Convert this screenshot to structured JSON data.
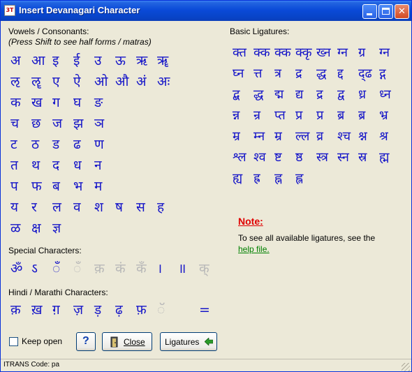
{
  "window": {
    "title": "Insert Devanagari Character",
    "app_icon_text": "3T",
    "controls": {
      "minimize_icon": "minimize-icon",
      "maximize_icon": "maximize-icon",
      "close_glyph": "✕"
    }
  },
  "sections": {
    "vowels_title": "Vowels / Consonants:",
    "vowels_hint": "(Press Shift to see half forms / matras)",
    "special_title": "Special Characters:",
    "hindi_title": "Hindi / Marathi Characters:",
    "ligatures_title": "Basic Ligatures:"
  },
  "vowels_rows": [
    [
      "अ",
      "आ",
      "इ",
      "ई",
      "उ",
      "ऊ",
      "ऋ",
      "ॠ"
    ],
    [
      "ऌ",
      "ॡ",
      "ए",
      "ऐ",
      "ओ",
      "औ",
      "अं",
      "अः"
    ],
    [
      "क",
      "ख",
      "ग",
      "घ",
      "ङ"
    ],
    [
      "च",
      "छ",
      "ज",
      "झ",
      "ञ"
    ],
    [
      "ट",
      "ठ",
      "ड",
      "ढ",
      "ण"
    ],
    [
      "त",
      "थ",
      "द",
      "ध",
      "न"
    ],
    [
      "प",
      "फ",
      "ब",
      "भ",
      "म"
    ],
    [
      "य",
      "र",
      "ल",
      "व",
      "श",
      "ष",
      "स",
      "ह"
    ],
    [
      "ळ",
      "क्ष",
      "ज्ञ"
    ]
  ],
  "special_chars": [
    {
      "c": "ॐ",
      "dis": false
    },
    {
      "c": "ऽ",
      "dis": false
    },
    {
      "c": "ँ",
      "dis": false
    },
    {
      "c": "ँ",
      "dis": true
    },
    {
      "c": "क़",
      "dis": true
    },
    {
      "c": "कं",
      "dis": true
    },
    {
      "c": "कँ",
      "dis": true
    },
    {
      "c": "।",
      "dis": false
    },
    {
      "c": "॥",
      "dis": false
    },
    {
      "c": "क्",
      "dis": true
    }
  ],
  "hindi_chars": [
    {
      "c": "क़",
      "dis": false
    },
    {
      "c": "ख़",
      "dis": false
    },
    {
      "c": "ग़",
      "dis": false
    },
    {
      "c": "ज़",
      "dis": false
    },
    {
      "c": "ड़",
      "dis": false
    },
    {
      "c": "ढ़",
      "dis": false
    },
    {
      "c": "फ़",
      "dis": false
    },
    {
      "c": "ॅ",
      "dis": true
    },
    {
      "c": "",
      "dis": true
    },
    {
      "c": "=",
      "dis": false
    }
  ],
  "ligature_rows": [
    [
      "क्त",
      "क्क",
      "क्क",
      "क्कृ",
      "ख्न",
      "ग्न",
      "ग्र",
      "ग्न"
    ],
    [
      "घ्न",
      "त्त",
      "त्र",
      "द्र",
      "द्ध",
      "द्द",
      "द्ढ",
      "द्ग"
    ],
    [
      "द्ब",
      "द्ध",
      "द्म",
      "द्य",
      "द्र",
      "द्व",
      "ध्र",
      "ध्न"
    ],
    [
      "न्न",
      "न्र",
      "प्त",
      "प्र",
      "प्र",
      "ब्र",
      "ब्र",
      "भ्र"
    ],
    [
      "म्र",
      "म्न",
      "म्र",
      "ल्ल",
      "व्र",
      "श्च",
      "श्न",
      "श्र"
    ],
    [
      "श्ल",
      "श्व",
      "ष्ट",
      "ष्ठ",
      "स्त्र",
      "स्न",
      "स्र",
      "ह्म"
    ],
    [
      "ह्य",
      "ह्र",
      "ह्न",
      "ह्ल"
    ]
  ],
  "note": {
    "title": "Note:",
    "text_part1": "To see all available ligatures, see the",
    "link": "help file."
  },
  "controls": {
    "keep_open_label": "Keep open",
    "help_glyph": "?",
    "close_label": "Close",
    "ligatures_label": "Ligatures"
  },
  "status": {
    "itrans_code": "ITRANS Code: pa"
  },
  "colors": {
    "char_color": "#1414c8",
    "disabled_color": "#b8b8b8",
    "note_color": "#e00000",
    "link_color": "#008000"
  }
}
